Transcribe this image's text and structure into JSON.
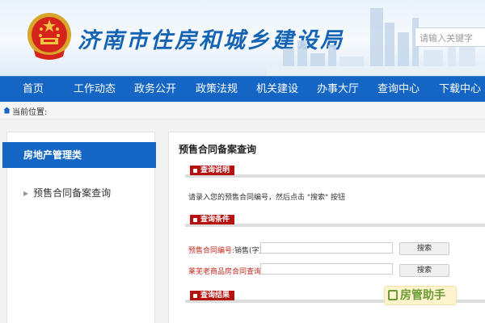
{
  "header": {
    "site_title": "济南市住房和城乡建设局",
    "search_placeholder": "请输入关键字"
  },
  "nav": {
    "items": [
      "首页",
      "工作动态",
      "政务公开",
      "政策法规",
      "机关建设",
      "办事大厅",
      "查询中心",
      "下载中心"
    ]
  },
  "breadcrumb": {
    "label": "当前位置:"
  },
  "sidebar": {
    "heading": "房地产管理类",
    "items": [
      "预售合同备案查询"
    ]
  },
  "main": {
    "title": "预售合同备案查询",
    "section_instructions": "查询说明",
    "instructions_text": "请录入您的预售合同编号，然后点击 \"搜索\" 按钮",
    "section_conditions": "查询条件",
    "field1_label": "预售合同编号:",
    "field1_prefix": "销售(字)",
    "field1_value": "",
    "field2_label": "莱芜老商品房合同查询:",
    "field2_value": "",
    "search_button": "搜索",
    "section_results": "查询结果"
  },
  "watermark": {
    "text": "房管助手"
  },
  "colors": {
    "nav_blue": "#1566c4",
    "section_red": "#b5130f",
    "label_red": "#c0271b",
    "title_blue": "#1463b4"
  }
}
